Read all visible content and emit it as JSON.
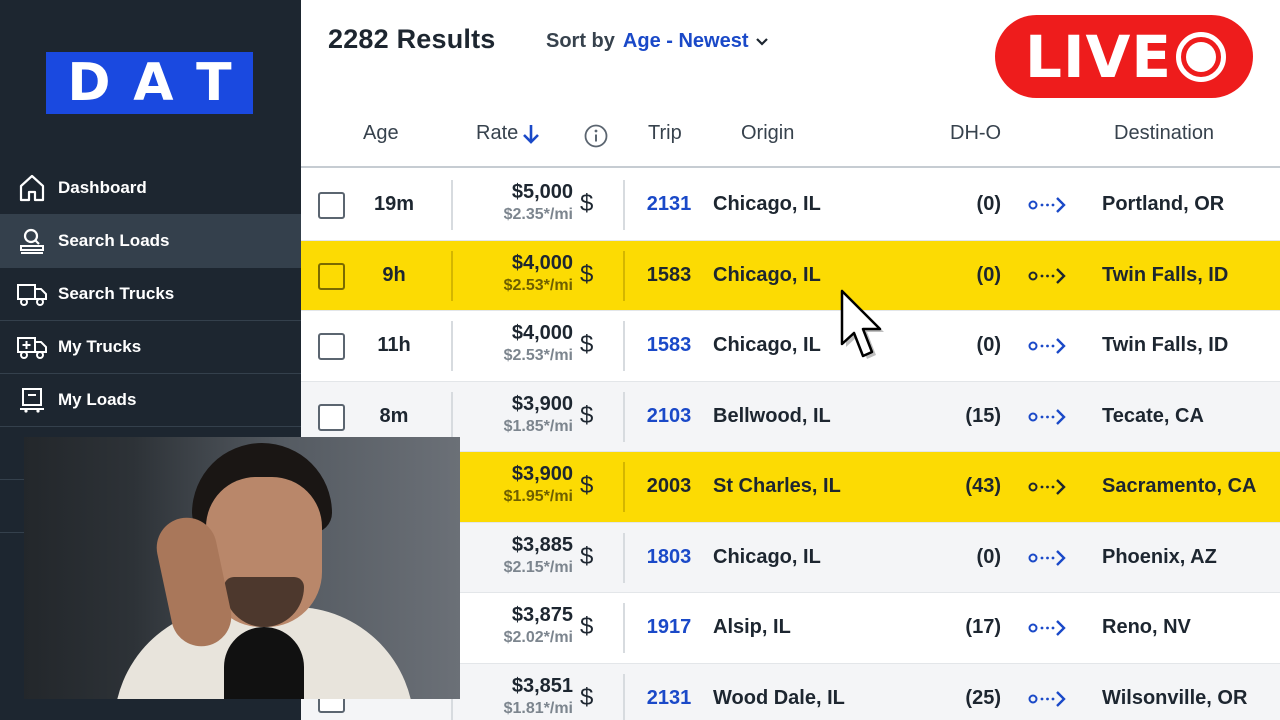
{
  "sidebar": {
    "logo_letters": [
      "D",
      "A",
      "T"
    ],
    "items": [
      {
        "label": "Dashboard",
        "icon": "home-icon",
        "active": false
      },
      {
        "label": "Search Loads",
        "icon": "search-loads-icon",
        "active": true
      },
      {
        "label": "Search Trucks",
        "icon": "truck-icon",
        "active": false
      },
      {
        "label": "My Trucks",
        "icon": "truck-plus-icon",
        "active": false
      },
      {
        "label": "My Loads",
        "icon": "loads-icon",
        "active": false
      }
    ]
  },
  "header": {
    "results": "2282 Results",
    "sort_label": "Sort by",
    "sort_value": "Age - Newest"
  },
  "live_badge": "LIVE",
  "columns": {
    "age": "Age",
    "rate": "Rate",
    "trip": "Trip",
    "origin": "Origin",
    "dho": "DH-O",
    "destination": "Destination"
  },
  "rows": [
    {
      "age": "19m",
      "rate": "$5,000",
      "rpm": "$2.35*/mi",
      "trip": "2131",
      "origin": "Chicago, IL",
      "dho": "(0)",
      "destination": "Portland, OR",
      "style": "white"
    },
    {
      "age": "9h",
      "rate": "$4,000",
      "rpm": "$2.53*/mi",
      "trip": "1583",
      "origin": "Chicago, IL",
      "dho": "(0)",
      "destination": "Twin Falls, ID",
      "style": "highlight"
    },
    {
      "age": "11h",
      "rate": "$4,000",
      "rpm": "$2.53*/mi",
      "trip": "1583",
      "origin": "Chicago, IL",
      "dho": "(0)",
      "destination": "Twin Falls, ID",
      "style": "white"
    },
    {
      "age": "8m",
      "rate": "$3,900",
      "rpm": "$1.85*/mi",
      "trip": "2103",
      "origin": "Bellwood, IL",
      "dho": "(15)",
      "destination": "Tecate, CA",
      "style": "alt"
    },
    {
      "age": "",
      "rate": "$3,900",
      "rpm": "$1.95*/mi",
      "trip": "2003",
      "origin": "St Charles, IL",
      "dho": "(43)",
      "destination": "Sacramento, CA",
      "style": "highlight"
    },
    {
      "age": "",
      "rate": "$3,885",
      "rpm": "$2.15*/mi",
      "trip": "1803",
      "origin": "Chicago, IL",
      "dho": "(0)",
      "destination": "Phoenix, AZ",
      "style": "alt"
    },
    {
      "age": "",
      "rate": "$3,875",
      "rpm": "$2.02*/mi",
      "trip": "1917",
      "origin": "Alsip, IL",
      "dho": "(17)",
      "destination": "Reno, NV",
      "style": "white"
    },
    {
      "age": "",
      "rate": "$3,851",
      "rpm": "$1.81*/mi",
      "trip": "2131",
      "origin": "Wood Dale, IL",
      "dho": "(25)",
      "destination": "Wilsonville, OR",
      "style": "alt"
    }
  ],
  "colors": {
    "sidebar_bg": "#1d2630",
    "logo_blue": "#1a49e0",
    "link_blue": "#1a49c8",
    "highlight_yellow": "#fcdb03",
    "live_red": "#ee1c1c"
  }
}
